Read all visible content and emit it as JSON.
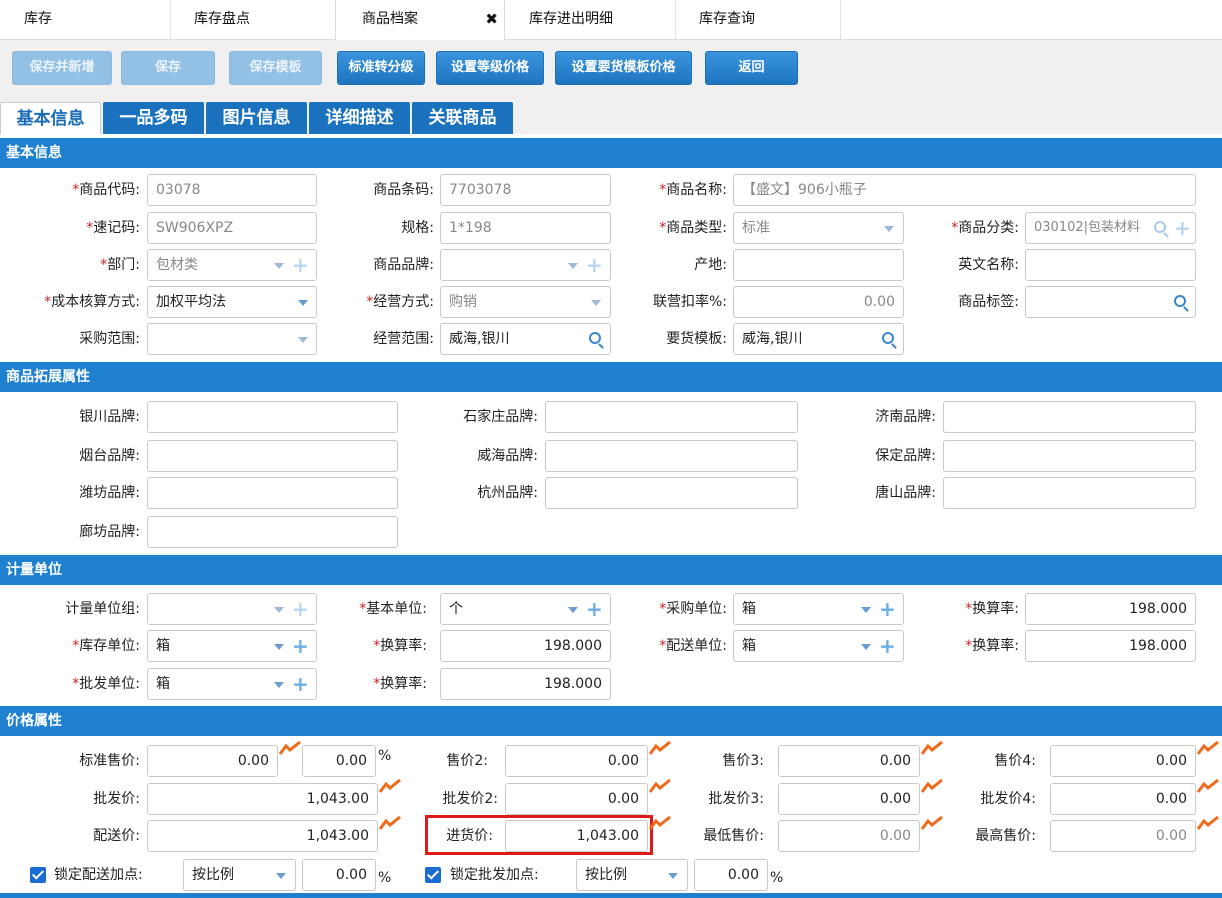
{
  "top_tabs": [
    "库存",
    "库存盘点",
    "商品档案",
    "库存进出明细",
    "库存查询"
  ],
  "toolbar": [
    "保存并新增",
    "保存",
    "保存模板",
    "标准转分级",
    "设置等级价格",
    "设置要货模板价格",
    "返回"
  ],
  "form_tabs": [
    "基本信息",
    "一品多码",
    "图片信息",
    "详细描述",
    "关联商品"
  ],
  "sections": {
    "basic": "基本信息",
    "ext": "商品拓展属性",
    "unit": "计量单位",
    "price": "价格属性"
  },
  "basic": {
    "code_label": "商品代码:",
    "code": "03078",
    "barcode_label": "商品条码:",
    "barcode": "7703078",
    "name_label": "商品名称:",
    "name": "【盛文】906小瓶子",
    "quick_label": "速记码:",
    "quick": "SW906XPZ",
    "spec_label": "规格:",
    "spec": "1*198",
    "type_label": "商品类型:",
    "type": "标准",
    "category_label": "商品分类:",
    "category": "030102|包装材料",
    "dept_label": "部门:",
    "dept": "包材类",
    "brand_label": "商品品牌:",
    "brand": "",
    "origin_label": "产地:",
    "origin": "",
    "en_label": "英文名称:",
    "en": "",
    "cost_label": "成本核算方式:",
    "cost": "加权平均法",
    "mode_label": "经营方式:",
    "mode": "购销",
    "rate_label": "联营扣率%:",
    "rate": "0.00",
    "tag_label": "商品标签:",
    "tag": "",
    "purchase_label": "采购范围:",
    "purchase": "",
    "scope_label": "经营范围:",
    "scope": "威海,银川",
    "template_label": "要货模板:",
    "template": "威海,银川"
  },
  "ext": {
    "yinchuan": "银川品牌:",
    "shijiazhuang": "石家庄品牌:",
    "jinan": "济南品牌:",
    "yantai": "烟台品牌:",
    "weihai": "威海品牌:",
    "baoding": "保定品牌:",
    "weifang": "潍坊品牌:",
    "hangzhou": "杭州品牌:",
    "tangshan": "唐山品牌:",
    "langfang": "廊坊品牌:"
  },
  "unit": {
    "group_label": "计量单位组:",
    "group": "",
    "base_label": "基本单位:",
    "base": "个",
    "purchase_label": "采购单位:",
    "purchase": "箱",
    "rate1_label": "换算率:",
    "rate1": "198.000",
    "stock_label": "库存单位:",
    "stock": "箱",
    "rate2_label": "换算率:",
    "rate2": "198.000",
    "dist_label": "配送单位:",
    "dist": "箱",
    "rate3_label": "换算率:",
    "rate3": "198.000",
    "wholesale_label": "批发单位:",
    "wholesale": "箱",
    "rate4_label": "换算率:",
    "rate4": "198.000"
  },
  "price": {
    "std_label": "标准售价:",
    "std": "0.00",
    "std_pct": "0.00",
    "pct_sign": "%",
    "p2_label": "售价2:",
    "p2": "0.00",
    "p3_label": "售价3:",
    "p3": "0.00",
    "p4_label": "售价4:",
    "p4": "0.00",
    "ws_label": "批发价:",
    "ws": "1,043.00",
    "ws2_label": "批发价2:",
    "ws2": "0.00",
    "ws3_label": "批发价3:",
    "ws3": "0.00",
    "ws4_label": "批发价4:",
    "ws4": "0.00",
    "dist_label": "配送价:",
    "dist": "1,043.00",
    "buy_label": "进货价:",
    "buy": "1,043.00",
    "min_label": "最低售价:",
    "min": "0.00",
    "max_label": "最高售价:",
    "max": "0.00",
    "lock_dist_label": "锁定配送加点:",
    "lock_dist_mode": "按比例",
    "lock_dist_pct": "0.00",
    "lock_ws_label": "锁定批发加点:",
    "lock_ws_mode": "按比例",
    "lock_ws_pct": "0.00"
  },
  "colors": {
    "accent": "#2080d0",
    "required": "#d21f1f",
    "highlight": "#e01a1a"
  }
}
